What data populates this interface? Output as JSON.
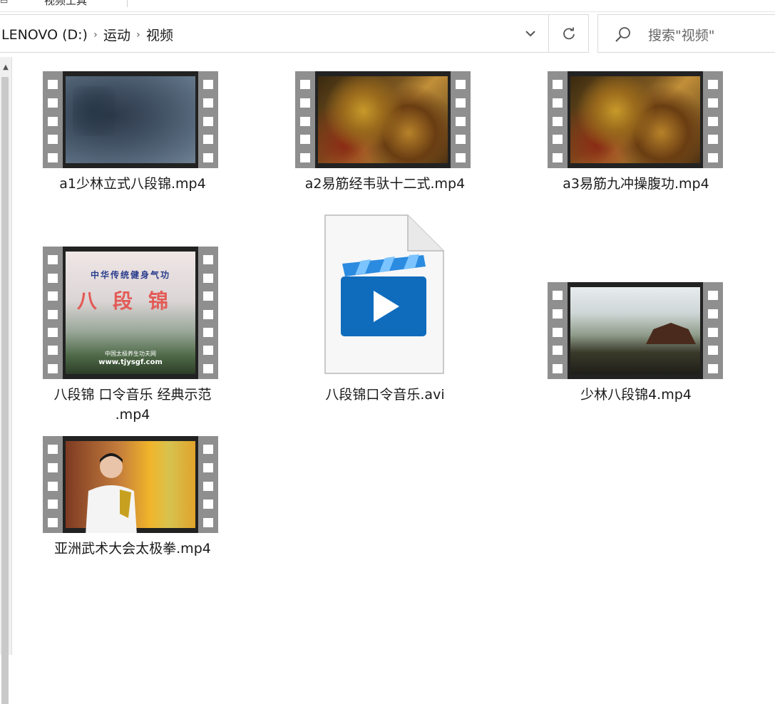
{
  "window": {
    "tab_text": "视频工具"
  },
  "address_bar": {
    "breadcrumbs": [
      "LENOVO (D:)",
      "运动",
      "视频"
    ]
  },
  "search": {
    "placeholder": "搜索\"视频\""
  },
  "files": [
    {
      "name": "a1少林立式八段锦.mp4",
      "type": "video-thumbnail"
    },
    {
      "name": "a2易筋经韦驮十二式.mp4",
      "type": "video-thumbnail"
    },
    {
      "name": "a3易筋九冲操腹功.mp4",
      "type": "video-thumbnail"
    },
    {
      "name_line1": "八段锦 口令音乐 经典示范",
      "name_line2": ".mp4",
      "type": "video-thumbnail",
      "thumb_text": {
        "line1": "中华传统健身气功",
        "line2": "八段锦",
        "line3": "中国太极养生功夫网",
        "line4": "www.tjysgf.com"
      }
    },
    {
      "name": "八段锦口令音乐.avi",
      "type": "video-file-icon"
    },
    {
      "name": "少林八段锦4.mp4",
      "type": "video-thumbnail"
    },
    {
      "name": "亚洲武术大会太极拳.mp4",
      "type": "video-thumbnail"
    }
  ],
  "colors": {
    "accent_blue": "#0f6cbd",
    "film_gray": "#8f8f8f"
  }
}
